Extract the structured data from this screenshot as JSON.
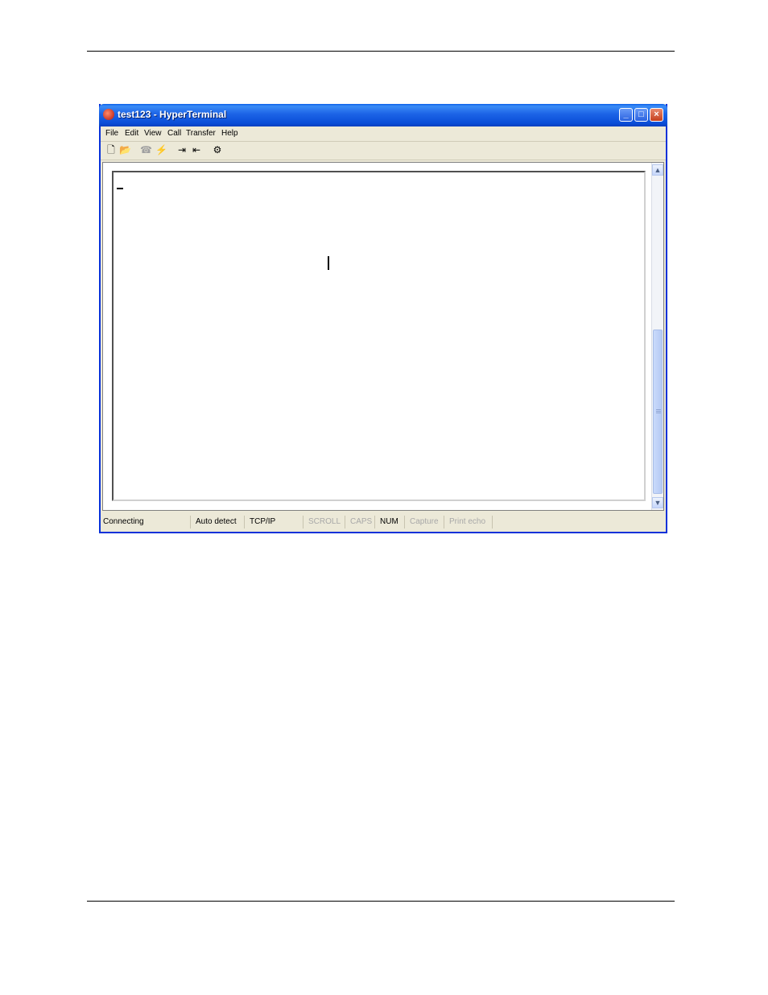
{
  "window": {
    "title": "test123 - HyperTerminal",
    "controls": {
      "minimize": "_",
      "maximize": "□",
      "close": "×"
    }
  },
  "menu": {
    "items": [
      "File",
      "Edit",
      "View",
      "Call",
      "Transfer",
      "Help"
    ]
  },
  "toolbar": {
    "buttons": [
      {
        "icon": "new-icon",
        "glyph": "🗋",
        "enabled": true
      },
      {
        "icon": "open-icon",
        "glyph": "📂",
        "enabled": true
      },
      {
        "icon": "call-icon",
        "glyph": "☎",
        "enabled": false
      },
      {
        "icon": "disconnect-icon",
        "glyph": "⚡",
        "enabled": true
      },
      {
        "icon": "send-icon",
        "glyph": "⇥",
        "enabled": true
      },
      {
        "icon": "receive-icon",
        "glyph": "⇤",
        "enabled": true
      },
      {
        "icon": "properties-icon",
        "glyph": "⚙",
        "enabled": true
      }
    ]
  },
  "statusbar": {
    "connection": "Connecting",
    "detect": "Auto detect",
    "protocol": "TCP/IP",
    "scroll": "SCROLL",
    "caps": "CAPS",
    "num": "NUM",
    "capture": "Capture",
    "print_echo": "Print echo"
  }
}
